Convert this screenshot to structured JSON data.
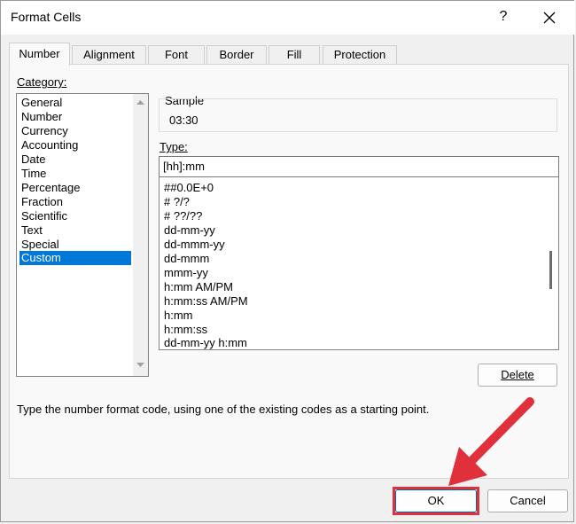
{
  "window": {
    "title": "Format Cells",
    "help_label": "?"
  },
  "tabs": [
    {
      "label": "Number",
      "active": true
    },
    {
      "label": "Alignment",
      "active": false
    },
    {
      "label": "Font",
      "active": false
    },
    {
      "label": "Border",
      "active": false
    },
    {
      "label": "Fill",
      "active": false
    },
    {
      "label": "Protection",
      "active": false
    }
  ],
  "category": {
    "label": "Category:",
    "items": [
      "General",
      "Number",
      "Currency",
      "Accounting",
      "Date",
      "Time",
      "Percentage",
      "Fraction",
      "Scientific",
      "Text",
      "Special",
      "Custom"
    ],
    "selected": "Custom"
  },
  "sample": {
    "label": "Sample",
    "value": "03:30"
  },
  "type": {
    "label": "Type:",
    "value": "[hh]:mm",
    "items": [
      "##0.0E+0",
      "# ?/?",
      "# ??/??",
      "dd-mm-yy",
      "dd-mmm-yy",
      "dd-mmm",
      "mmm-yy",
      "h:mm AM/PM",
      "h:mm:ss AM/PM",
      "h:mm",
      "h:mm:ss",
      "dd-mm-yy h:mm"
    ]
  },
  "buttons": {
    "delete": "Delete",
    "ok": "OK",
    "cancel": "Cancel"
  },
  "hint": "Type the number format code, using one of the existing codes as a starting point.",
  "colors": {
    "selection": "#0078d7",
    "highlight": "#e0303c",
    "panel": "#f9f9f9"
  }
}
